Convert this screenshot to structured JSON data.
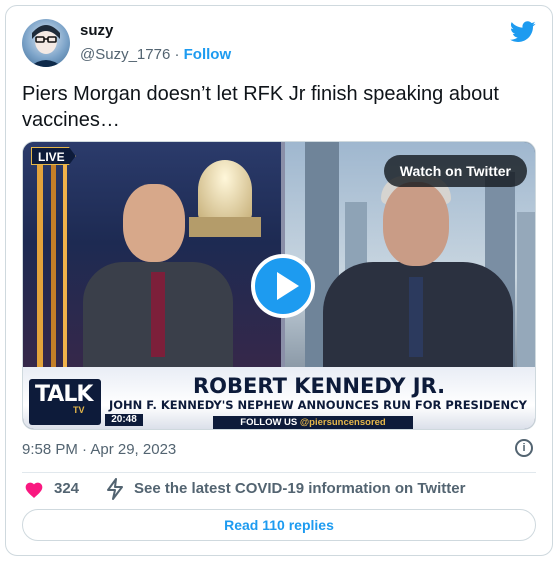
{
  "author": {
    "name": "suzy",
    "handle": "@Suzy_1776",
    "separator": "·",
    "follow_label": "Follow"
  },
  "tweet": {
    "text": "Piers Morgan doesn’t let RFK Jr finish speaking about vaccines…",
    "timestamp": "9:58 PM · Apr 29, 2023"
  },
  "video": {
    "live_badge": "LIVE",
    "watch_label": "Watch on Twitter",
    "channel_logo": "TALK",
    "channel_sub": "TV",
    "clock": "20:48",
    "headline": "ROBERT KENNEDY JR.",
    "subheadline": "JOHN F. KENNEDY'S NEPHEW ANNOUNCES RUN FOR PRESIDENCY",
    "follow_prefix": "FOLLOW US",
    "follow_handle": "@piersuncensored"
  },
  "actions": {
    "likes": "324",
    "info_link": "See the latest COVID-19 information on Twitter",
    "replies_label": "Read 110 replies"
  },
  "icons": {
    "brand": "twitter-bird-icon",
    "info": "info-icon",
    "like": "heart-icon",
    "info_bolt": "lightning-icon",
    "play": "play-icon"
  },
  "colors": {
    "accent": "#1d9bf0",
    "like": "#f91880",
    "muted_text": "#536471",
    "border": "#cfd9de"
  }
}
